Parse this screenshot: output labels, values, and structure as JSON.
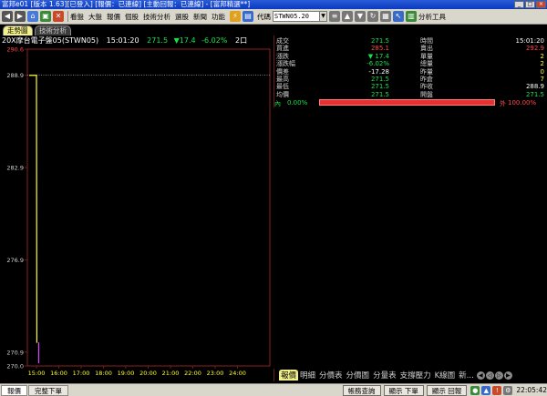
{
  "window": {
    "title": "富邦e01 [版本 1.63][已登入] [報價：已連線] [主動回報：已連線] - [富邦精選**]"
  },
  "toolbar": {
    "menus": [
      "看盤",
      "大盤",
      "報價",
      "個股",
      "技術分析",
      "選股",
      "新聞",
      "功能"
    ],
    "code_label": "代碼",
    "code_value": "STWN05.20",
    "analysis_tools": "分析工具"
  },
  "tabs": {
    "active": "走勢圖",
    "inactive": "技術分析"
  },
  "stock_header": {
    "name": "20X摩台電子盤05(STWN05)",
    "time": "15:01:20",
    "price": "271.5",
    "change": "17.4",
    "change_pct": "-6.02%",
    "extra": "2口"
  },
  "quote": {
    "left": [
      {
        "label": "成交",
        "value": "271.5",
        "color": "green"
      },
      {
        "label": "買進",
        "value": "285.1",
        "color": "red"
      },
      {
        "label": "漲跌",
        "value": "▼ 17.4",
        "color": "green"
      },
      {
        "label": "漲跌幅",
        "value": "-6.02%",
        "color": "green"
      },
      {
        "label": "價差",
        "value": "-17.28",
        "color": "white"
      },
      {
        "label": "最高",
        "value": "271.5",
        "color": "green"
      },
      {
        "label": "最低",
        "value": "271.5",
        "color": "green"
      },
      {
        "label": "均價",
        "value": "271.5",
        "color": "green"
      }
    ],
    "right": [
      {
        "label": "時間",
        "value": "15:01:20",
        "color": "white"
      },
      {
        "label": "賣出",
        "value": "292.9",
        "color": "red"
      },
      {
        "label": "單量",
        "value": "2",
        "color": "yellow"
      },
      {
        "label": "總量",
        "value": "2",
        "color": "yellow"
      },
      {
        "label": "昨量",
        "value": "0",
        "color": "yellow"
      },
      {
        "label": "昨倉",
        "value": "7",
        "color": "yellow"
      },
      {
        "label": "昨收",
        "value": "288.9",
        "color": "white"
      },
      {
        "label": "開盤",
        "value": "271.5",
        "color": "green"
      }
    ]
  },
  "inner_outer": {
    "inner_label": "內",
    "inner_pct": "0.00%",
    "outer_label": "外",
    "outer_pct": "100.00%",
    "outer_fraction": 1.0
  },
  "chart_data": {
    "type": "line",
    "y_ticks": [
      "290.6",
      "288.9",
      "282.9",
      "276.9",
      "270.9",
      "270.0"
    ],
    "x_ticks": [
      "15:00",
      "16:00",
      "17:00",
      "18:00",
      "19:00",
      "20:00",
      "21:00",
      "22:00",
      "23:00",
      "24:00"
    ],
    "ylim": [
      270.0,
      290.6
    ],
    "reference_price": 288.9,
    "series": [
      {
        "x": [
          "15:00",
          "15:01"
        ],
        "values": [
          288.9,
          271.5
        ],
        "color": "#ffff30"
      }
    ],
    "volume": [
      {
        "x": "15:01",
        "value": 2,
        "color": "#e040ff"
      }
    ]
  },
  "right_tabs": [
    "報價",
    "明細",
    "分價表",
    "分價圖",
    "分量表",
    "支撐壓力",
    "K線圖",
    "新..."
  ],
  "status": {
    "tabs": [
      "報價",
      "完整下單"
    ],
    "buttons": [
      "帳務查詢",
      "顯示 下單",
      "顯示 回報"
    ],
    "time": "22:05:42"
  }
}
